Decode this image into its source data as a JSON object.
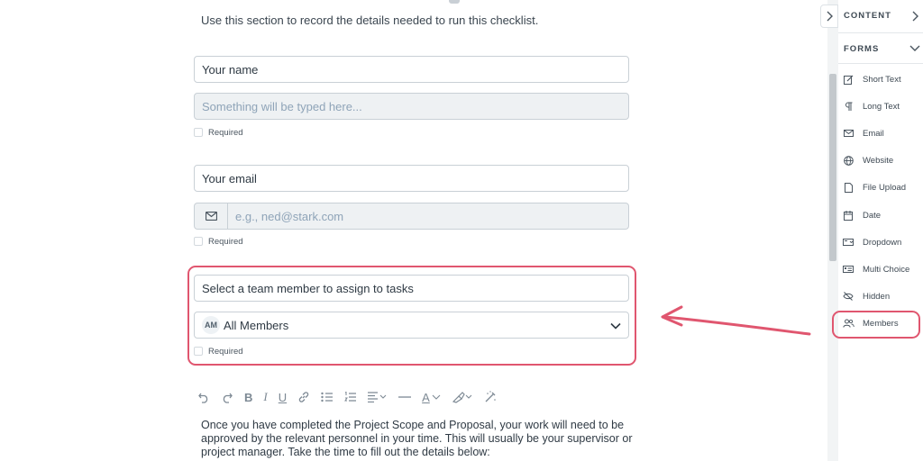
{
  "intro_text": "Use this section to record the details needed to run this checklist.",
  "form": {
    "name_label": "Your name",
    "name_placeholder": "Something will be typed here...",
    "email_label": "Your email",
    "email_placeholder": "e.g., ned@stark.com",
    "members_label": "Select a team member to assign to tasks",
    "members_badge": "AM",
    "members_value": "All Members",
    "required_label": "Required"
  },
  "toolbar": {
    "icons": [
      "undo-icon",
      "redo-icon",
      "bold-icon",
      "italic-icon",
      "underline-icon",
      "link-icon",
      "bullet-list-icon",
      "numbered-list-icon",
      "align-icon",
      "horizontal-rule-icon",
      "text-color-icon",
      "highlight-icon",
      "clear-format-icon"
    ],
    "bold": "B",
    "italic": "I",
    "underline": "U",
    "text_color": "A"
  },
  "body_paragraph": "Once you have completed the Project Scope and Proposal, your work will need to be approved by the relevant personnel in your time. This will usually be your supervisor or project manager. Take the time to fill out the details below:",
  "sidebar": {
    "content_header": "CONTENT",
    "forms_header": "FORMS",
    "items": [
      {
        "label": "Short Text",
        "icon": "edit-icon"
      },
      {
        "label": "Long Text",
        "icon": "paragraph-icon"
      },
      {
        "label": "Email",
        "icon": "envelope-icon"
      },
      {
        "label": "Website",
        "icon": "globe-icon"
      },
      {
        "label": "File Upload",
        "icon": "file-icon"
      },
      {
        "label": "Date",
        "icon": "calendar-icon"
      },
      {
        "label": "Dropdown",
        "icon": "dropdown-icon"
      },
      {
        "label": "Multi Choice",
        "icon": "multi-choice-icon"
      },
      {
        "label": "Hidden",
        "icon": "eye-slash-icon"
      },
      {
        "label": "Members",
        "icon": "users-icon"
      }
    ]
  },
  "colors": {
    "highlight": "#e0566f",
    "field_border": "#c9d0d6",
    "disabled_bg": "#eef1f3",
    "placeholder": "#8fa4b8"
  }
}
